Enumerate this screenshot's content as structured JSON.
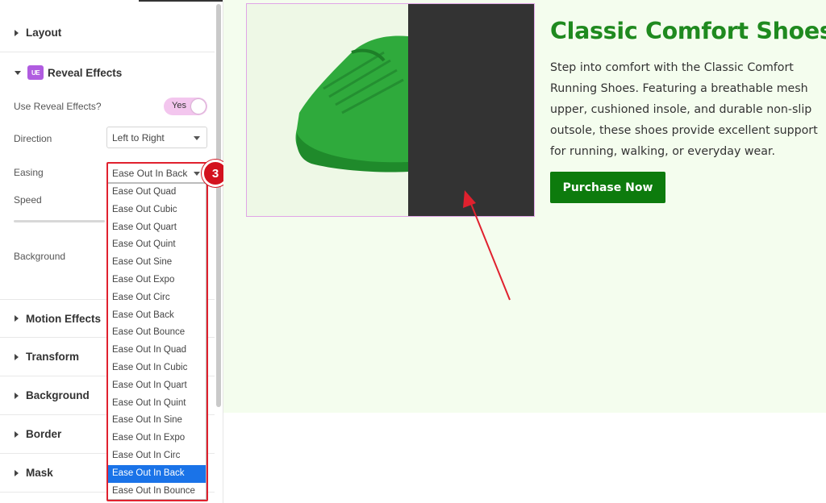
{
  "panel": {
    "sections": {
      "layout": "Layout",
      "reveal": "Reveal Effects",
      "reveal_icon": "UE",
      "motion": "Motion Effects",
      "transform": "Transform",
      "background": "Background",
      "border": "Border",
      "mask": "Mask"
    },
    "controls": {
      "use_reveal_label": "Use Reveal Effects?",
      "use_reveal_value": "Yes",
      "direction_label": "Direction",
      "direction_value": "Left to Right",
      "easing_label": "Easing",
      "easing_value": "Ease Out In Back",
      "speed_label": "Speed",
      "background_label": "Background"
    },
    "easing_options": [
      "Ease Out Quad",
      "Ease Out Cubic",
      "Ease Out Quart",
      "Ease Out Quint",
      "Ease Out Sine",
      "Ease Out Expo",
      "Ease Out Circ",
      "Ease Out Back",
      "Ease Out Bounce",
      "Ease Out In Quad",
      "Ease Out In Cubic",
      "Ease Out In Quart",
      "Ease Out In Quint",
      "Ease Out In Sine",
      "Ease Out In Expo",
      "Ease Out In Circ",
      "Ease Out In Back",
      "Ease Out In Bounce"
    ],
    "selected_option": "Ease Out In Back",
    "step_badge": "3"
  },
  "preview": {
    "title": "Classic Comfort Shoes",
    "description": "Step into comfort with the Classic Comfort Running Shoes. Featuring a breathable mesh upper, cushioned insole, and durable non-slip outsole, these shoes provide excellent support for running, walking, or everyday wear.",
    "button": "Purchase Now"
  },
  "colors": {
    "accent_green": "#1f8a1f",
    "button_green": "#0d7b0d",
    "preview_bg": "#f4fdee",
    "annotation_red": "#e0212e",
    "selected_blue": "#1a73e8"
  }
}
